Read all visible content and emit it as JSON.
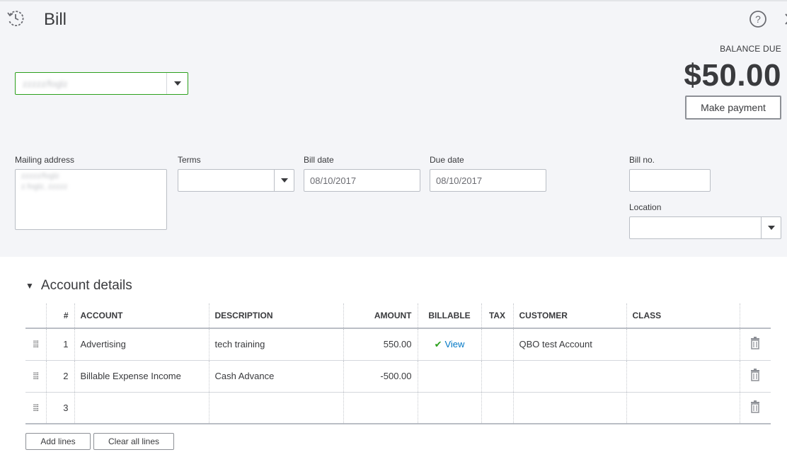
{
  "header": {
    "title": "Bill",
    "history_icon": "history-icon",
    "help_icon": "help-icon",
    "close_icon": "close-icon"
  },
  "vendor": {
    "value": "zzzzz/foglz"
  },
  "balance": {
    "label": "BALANCE DUE",
    "amount": "$50.00",
    "make_payment_label": "Make payment"
  },
  "fields": {
    "mailing_address": {
      "label": "Mailing address",
      "lines": [
        "zzzzz/foglz",
        "z.foglz, zzzzz"
      ]
    },
    "terms": {
      "label": "Terms",
      "value": ""
    },
    "bill_date": {
      "label": "Bill date",
      "value": "08/10/2017"
    },
    "due_date": {
      "label": "Due date",
      "value": "08/10/2017"
    },
    "bill_no": {
      "label": "Bill no.",
      "value": ""
    },
    "location": {
      "label": "Location",
      "value": ""
    }
  },
  "account_details": {
    "title": "Account details",
    "columns": [
      "#",
      "ACCOUNT",
      "DESCRIPTION",
      "AMOUNT",
      "BILLABLE",
      "TAX",
      "CUSTOMER",
      "CLASS"
    ],
    "rows": [
      {
        "num": "1",
        "account": "Advertising",
        "description": "tech training",
        "amount": "550.00",
        "billable": "View",
        "billable_checked": true,
        "tax": "",
        "customer": "QBO test Account",
        "class": ""
      },
      {
        "num": "2",
        "account": "Billable Expense Income",
        "description": "Cash Advance",
        "amount": "-500.00",
        "billable": "",
        "billable_checked": false,
        "tax": "",
        "customer": "",
        "class": ""
      },
      {
        "num": "3",
        "account": "",
        "description": "",
        "amount": "",
        "billable": "",
        "billable_checked": false,
        "tax": "",
        "customer": "",
        "class": ""
      }
    ]
  },
  "buttons": {
    "add_lines": "Add lines",
    "clear_all_lines": "Clear all lines"
  },
  "colors": {
    "accent_green": "#2ca01c",
    "link_blue": "#0077c5",
    "header_bg": "#f4f5f8"
  }
}
